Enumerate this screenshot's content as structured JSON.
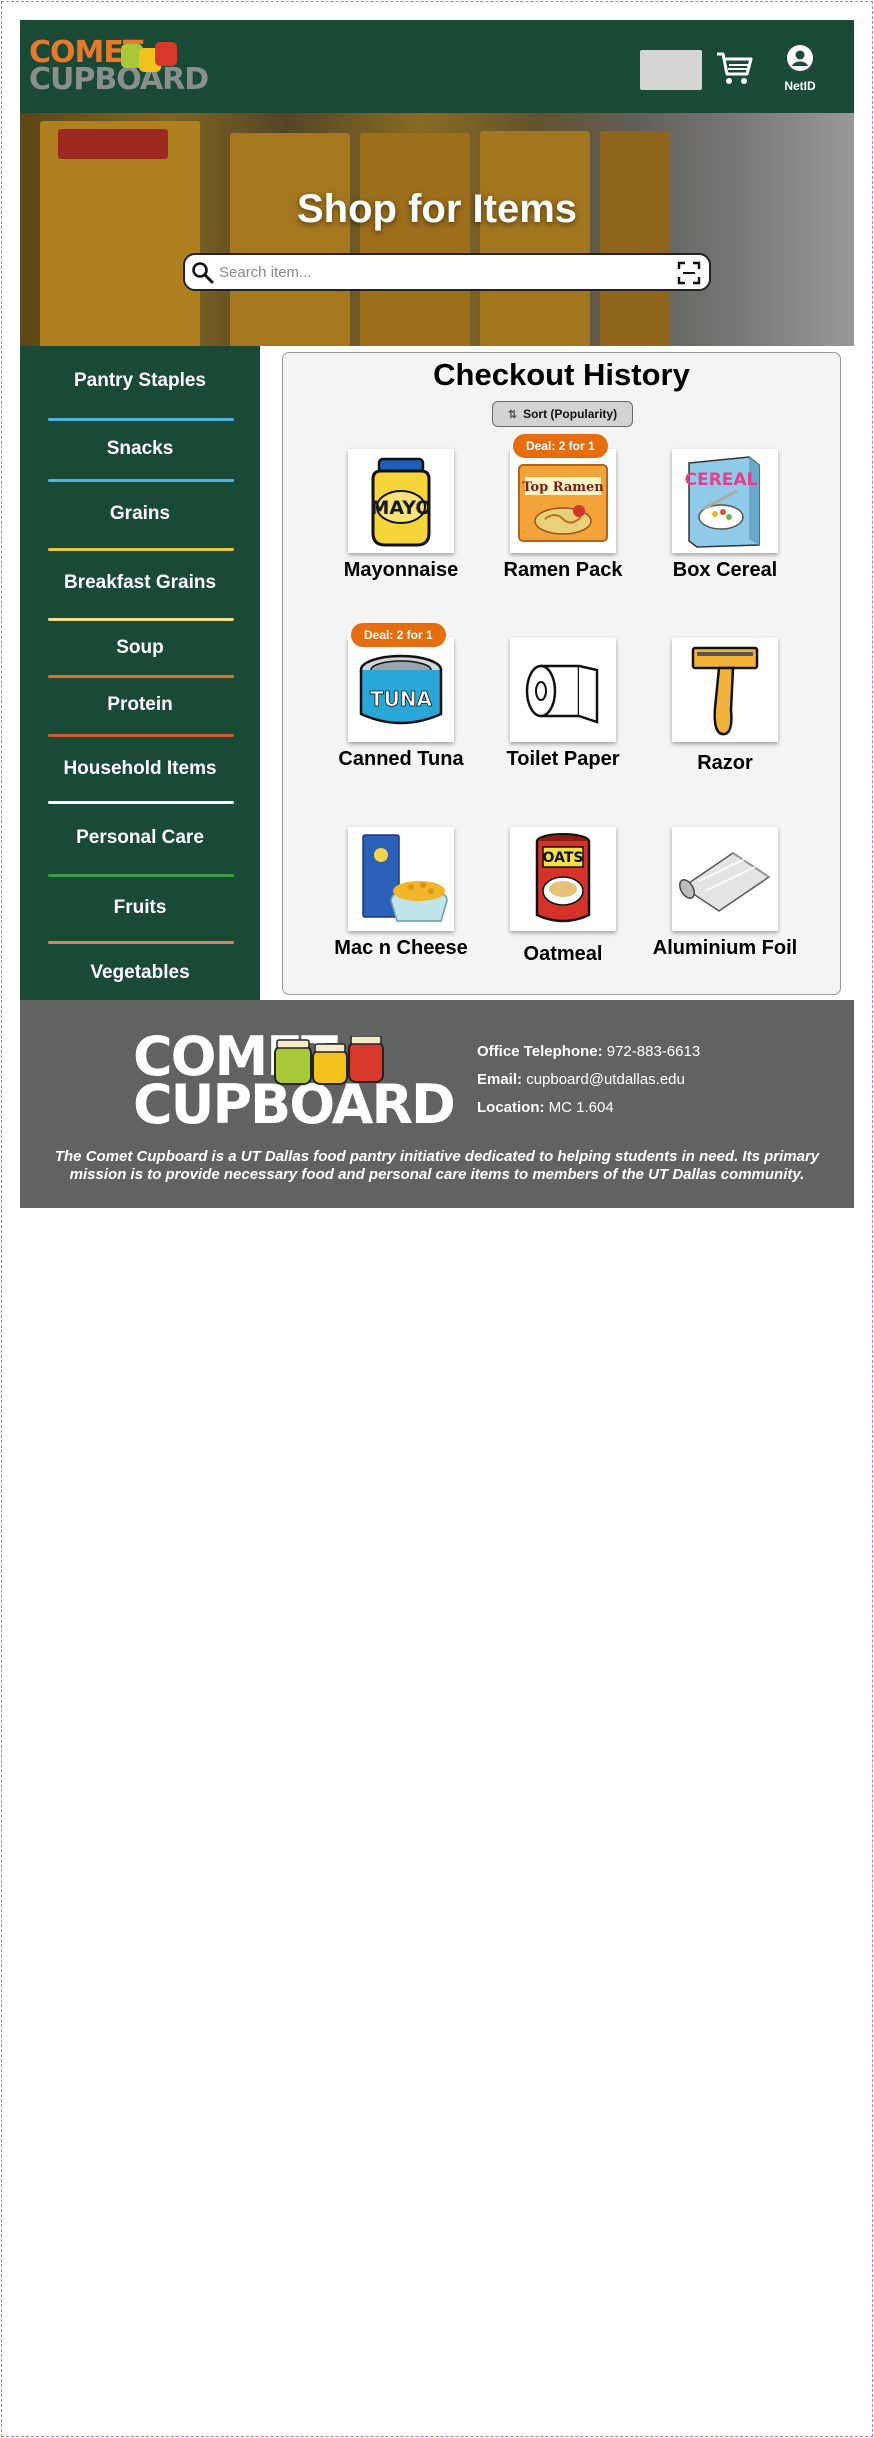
{
  "header": {
    "logo_line1": "COMET",
    "logo_line2": "CUPBOARD",
    "netid_label": "NetID"
  },
  "hero": {
    "title": "Shop for Items",
    "search_placeholder": "Search item..."
  },
  "sidebar": {
    "categories": [
      {
        "label": "Pantry Staples",
        "color": "#4fb3e0"
      },
      {
        "label": "Snacks",
        "color": "#4fb3e0"
      },
      {
        "label": "Grains",
        "color": "#e7c63b"
      },
      {
        "label": "Breakfast Grains",
        "color": "#f1e08a"
      },
      {
        "label": "Soup",
        "color": "#d9722e"
      },
      {
        "label": "Protein",
        "color": "#cf5a37"
      },
      {
        "label": "Household Items",
        "color": "#ffffff"
      },
      {
        "label": "Personal Care",
        "color": "#3a9b4a"
      },
      {
        "label": "Fruits",
        "color": "#e0805a"
      },
      {
        "label": "Vegetables",
        "color": null
      }
    ]
  },
  "main": {
    "title": "Checkout History",
    "sort_label": "Sort (Popularity)",
    "items": [
      {
        "name": "Mayonnaise",
        "icon": "mayo-jar-icon",
        "deal": null
      },
      {
        "name": "Ramen Pack",
        "icon": "ramen-pack-icon",
        "deal": "Deal: 2 for 1"
      },
      {
        "name": "Box Cereal",
        "icon": "cereal-box-icon",
        "deal": null
      },
      {
        "name": "Canned Tuna",
        "icon": "tuna-can-icon",
        "deal": "Deal: 2 for 1"
      },
      {
        "name": "Toilet Paper",
        "icon": "toilet-paper-icon",
        "deal": null
      },
      {
        "name": "Razor",
        "icon": "razor-icon",
        "deal": null
      },
      {
        "name": "Mac n Cheese",
        "icon": "mac-n-cheese-icon",
        "deal": null
      },
      {
        "name": "Oatmeal",
        "icon": "oatmeal-can-icon",
        "deal": null
      },
      {
        "name": "Aluminium Foil",
        "icon": "aluminium-foil-icon",
        "deal": null
      }
    ],
    "item_texts": {
      "mayo": "MAYO",
      "ramen": "Top Ramen",
      "cereal": "CEREAL",
      "tuna": "TUNA",
      "oats": "OATS"
    }
  },
  "footer": {
    "logo_line1": "COMET",
    "logo_line2": "CUPBOARD",
    "phone_label": "Office Telephone:",
    "phone_value": "972-883-6613",
    "email_label": "Email:",
    "email_value": "cupboard@utdallas.edu",
    "location_label": "Location:",
    "location_value": "MC 1.604",
    "mission": "The Comet Cupboard is a UT Dallas food pantry initiative dedicated to helping students in need. Its primary mission is to provide necessary food and personal care items to members of the UT Dallas community."
  },
  "colors": {
    "brand_green": "#1a4a36",
    "deal_orange": "#e56d10",
    "footer_gray": "#626262",
    "logo_orange": "#e8792c"
  }
}
